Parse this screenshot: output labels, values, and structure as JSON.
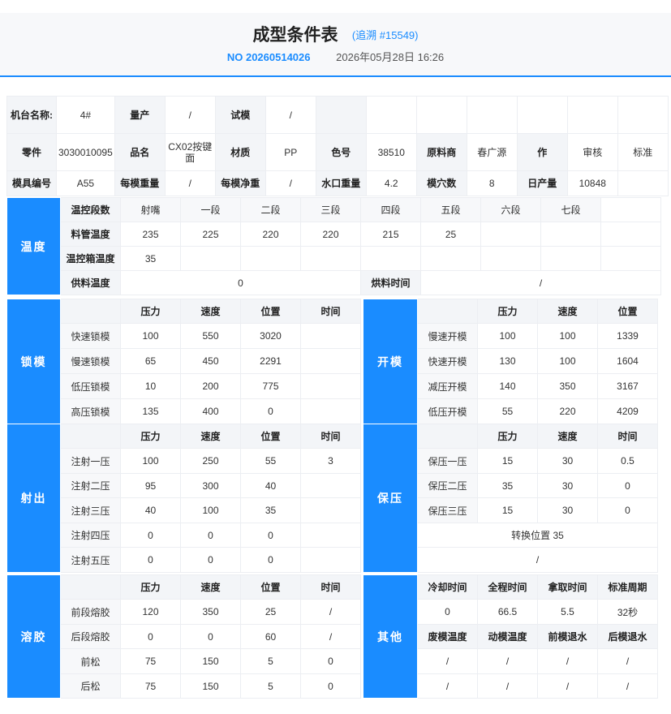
{
  "header": {
    "title": "成型条件表",
    "trace": "(追溯 #15549)",
    "no": "NO 20260514026",
    "date": "2026年05月28日 16:26"
  },
  "info": {
    "machine_label": "机台名称:",
    "machine_value": "4#",
    "production_label": "量产",
    "production_value": "/",
    "trial_label": "试模",
    "trial_value": "/",
    "part_label": "零件",
    "part_value": "3030010095",
    "name_label": "品名",
    "name_value": "CX02按键面",
    "material_label": "材质",
    "material_value": "PP",
    "color_label": "色号",
    "color_value": "38510",
    "supplier_label": "原料商",
    "supplier_value": "春广源",
    "op_label": "作",
    "review_label": "审核",
    "standard_label": "标准",
    "mold_label": "模具编号",
    "mold_value": "A55",
    "shot_weight_label": "每模重量",
    "shot_weight_value": "/",
    "net_weight_label": "每模净重",
    "net_weight_value": "/",
    "gate_weight_label": "水口重量",
    "gate_weight_value": "4.2",
    "cavity_label": "模穴数",
    "cavity_value": "8",
    "daily_label": "日产量",
    "daily_value": "10848"
  },
  "temperature": {
    "title": "温度",
    "header": [
      "温控段数",
      "射嘴",
      "一段",
      "二段",
      "三段",
      "四段",
      "五段",
      "六段",
      "七段"
    ],
    "barrel_label": "料管温度",
    "barrel": [
      "235",
      "225",
      "220",
      "220",
      "215",
      "25",
      "",
      ""
    ],
    "box_label": "温控箱温度",
    "box_value": "35",
    "feed_label": "供料温度",
    "feed_value": "0",
    "dry_label": "烘料时间",
    "dry_value": "/"
  },
  "clamp": {
    "title": "锁模",
    "header": [
      "",
      "压力",
      "速度",
      "位置",
      "时间"
    ],
    "rows": [
      [
        "快速锁模",
        "100",
        "550",
        "3020",
        ""
      ],
      [
        "慢速锁模",
        "65",
        "450",
        "2291",
        ""
      ],
      [
        "低压锁模",
        "10",
        "200",
        "775",
        ""
      ],
      [
        "高压锁模",
        "135",
        "400",
        "0",
        ""
      ]
    ]
  },
  "open": {
    "title": "开模",
    "header": [
      "",
      "压力",
      "速度",
      "位置"
    ],
    "rows": [
      [
        "慢速开模",
        "100",
        "100",
        "1339"
      ],
      [
        "快速开模",
        "130",
        "100",
        "1604"
      ],
      [
        "减压开模",
        "140",
        "350",
        "3167"
      ],
      [
        "低压开模",
        "55",
        "220",
        "4209"
      ]
    ]
  },
  "injection": {
    "title": "射出",
    "header": [
      "",
      "压力",
      "速度",
      "位置",
      "时间"
    ],
    "rows": [
      [
        "注射一压",
        "100",
        "250",
        "55",
        "3"
      ],
      [
        "注射二压",
        "95",
        "300",
        "40",
        ""
      ],
      [
        "注射三压",
        "40",
        "100",
        "35",
        ""
      ],
      [
        "注射四压",
        "0",
        "0",
        "0",
        ""
      ],
      [
        "注射五压",
        "0",
        "0",
        "0",
        ""
      ]
    ]
  },
  "holding": {
    "title": "保压",
    "header": [
      "",
      "压力",
      "速度",
      "时间"
    ],
    "rows": [
      [
        "保压一压",
        "15",
        "30",
        "0.5"
      ],
      [
        "保压二压",
        "35",
        "30",
        "0"
      ],
      [
        "保压三压",
        "15",
        "30",
        "0"
      ]
    ],
    "switch": "转换位置 35",
    "extra": "/"
  },
  "melt": {
    "title": "溶胶",
    "header": [
      "",
      "压力",
      "速度",
      "位置",
      "时间"
    ],
    "rows": [
      [
        "前段熔胶",
        "120",
        "350",
        "25",
        "/"
      ],
      [
        "后段熔胶",
        "0",
        "0",
        "60",
        "/"
      ],
      [
        "前松",
        "75",
        "150",
        "5",
        "0"
      ],
      [
        "后松",
        "75",
        "150",
        "5",
        "0"
      ]
    ]
  },
  "other": {
    "title": "其他",
    "header1": [
      "冷却时间",
      "全程时间",
      "拿取时间",
      "标准周期"
    ],
    "row1": [
      "0",
      "66.5",
      "5.5",
      "32秒"
    ],
    "header2": [
      "废模温度",
      "动模温度",
      "前模退水",
      "后模退水"
    ],
    "row2": [
      "/",
      "/",
      "/",
      "/"
    ],
    "row3": [
      "/",
      "/",
      "/",
      "/"
    ]
  }
}
